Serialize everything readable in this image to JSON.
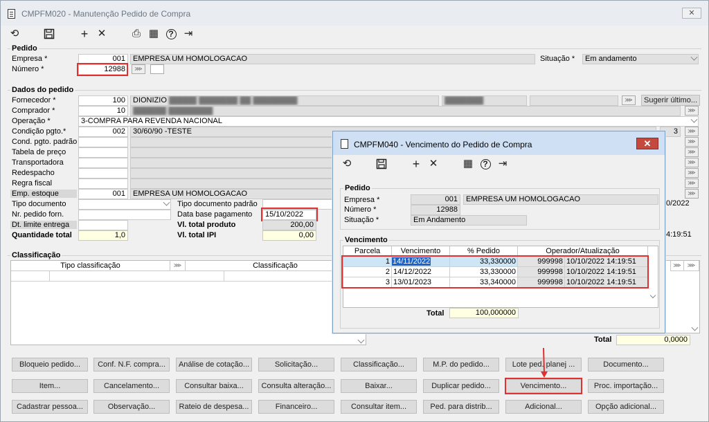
{
  "window": {
    "title": "CMPFM020 - Manutenção Pedido de Compra",
    "close": "✕"
  },
  "pedido": {
    "section": "Pedido",
    "empresa_label": "Empresa *",
    "empresa_code": "001",
    "empresa_name": "EMPRESA UM HOMOLOGACAO",
    "numero_label": "Número *",
    "numero": "12988",
    "situacao_label": "Situação *",
    "situacao": "Em andamento"
  },
  "dados": {
    "section": "Dados do pedido",
    "fornecedor_label": "Fornecedor *",
    "fornecedor_code": "100",
    "fornecedor_name": "DIONIZIO",
    "comprador_label": "Comprador *",
    "comprador_code": "10",
    "operacao_label": "Operação *",
    "operacao": "3-COMPRA PARA REVENDA NACIONAL",
    "condicao_label": "Condição pgto.*",
    "condicao_code": "002",
    "condicao_name": "30/60/90 -TESTE",
    "condicao_count": "3",
    "cond_padrao_label": "Cond. pgto. padrão",
    "tabela_label": "Tabela de preço",
    "transp_label": "Transportadora",
    "redesp_label": "Redespacho",
    "regra_label": "Regra fiscal",
    "emp_estoque_label": "Emp. estoque",
    "emp_estoque_code": "001",
    "emp_estoque_name": "EMPRESA UM HOMOLOGACAO",
    "tipo_doc_label": "Tipo documento",
    "tipo_doc_padrao_label": "Tipo documento padrão",
    "nr_forn_label": "Nr. pedido forn.",
    "data_base_label": "Data base pagamento",
    "data_base": "15/10/2022",
    "dt_limite_label": "Dt. limite entrega",
    "vl_total_prod_label": "Vl. total produto",
    "vl_total_prod": "200,00",
    "qtd_total_label": "Quantidade total",
    "qtd_total": "1,0",
    "vl_total_ipi_label": "Vl. total IPI",
    "vl_total_ipi": "0,00",
    "sugerir": "Sugerir último...",
    "date_right": "0/2022",
    "time_right": "4:19:51"
  },
  "classificacao": {
    "section": "Classificação",
    "col1": "Tipo classificação",
    "col2": "Classificação",
    "total_label": "Total",
    "total": "0,0000"
  },
  "buttons": [
    [
      "Bloqueio pedido...",
      "Conf. N.F. compra...",
      "Análise de cotação...",
      "Solicitação...",
      "Classificação...",
      "M.P. do pedido...",
      "Lote ped. planej ...",
      "Documento..."
    ],
    [
      "Item...",
      "Cancelamento...",
      "Consultar baixa...",
      "Consulta alteração...",
      "Baixar...",
      "Duplicar pedido...",
      "Vencimento...",
      "Proc. importação..."
    ],
    [
      "Cadastrar pessoa...",
      "Observação...",
      "Rateio de despesa...",
      "Financeiro...",
      "Consultar item...",
      "Ped. para distrib...",
      "Adicional...",
      "Opção adicional..."
    ]
  ],
  "dialog": {
    "title": "CMPFM040 - Vencimento do Pedido de Compra",
    "close": "✕",
    "pedido_section": "Pedido",
    "empresa_label": "Empresa *",
    "empresa_code": "001",
    "empresa_name": "EMPRESA UM HOMOLOGACAO",
    "numero_label": "Número *",
    "numero": "12988",
    "situacao_label": "Situação *",
    "situacao": "Em Andamento",
    "venc_section": "Vencimento",
    "headers": [
      "Parcela",
      "Vencimento",
      "% Pedido",
      "Operador/Atualização"
    ],
    "rows": [
      {
        "parcela": "1",
        "vencimento": "14/11/2022",
        "pct": "33,330000",
        "operador": "999998",
        "atualizacao": "10/10/2022 14:19:51"
      },
      {
        "parcela": "2",
        "vencimento": "14/12/2022",
        "pct": "33,330000",
        "operador": "999998",
        "atualizacao": "10/10/2022 14:19:51"
      },
      {
        "parcela": "3",
        "vencimento": "13/01/2023",
        "pct": "33,340000",
        "operador": "999998",
        "atualizacao": "10/10/2022 14:19:51"
      }
    ],
    "total_label": "Total",
    "total": "100,000000"
  },
  "icons": {
    "refresh": "⟲",
    "save": "💾",
    "add": "+",
    "delete": "✕",
    "print": "⎙",
    "calendar": "▦",
    "help": "?",
    "exit": "⇥"
  }
}
